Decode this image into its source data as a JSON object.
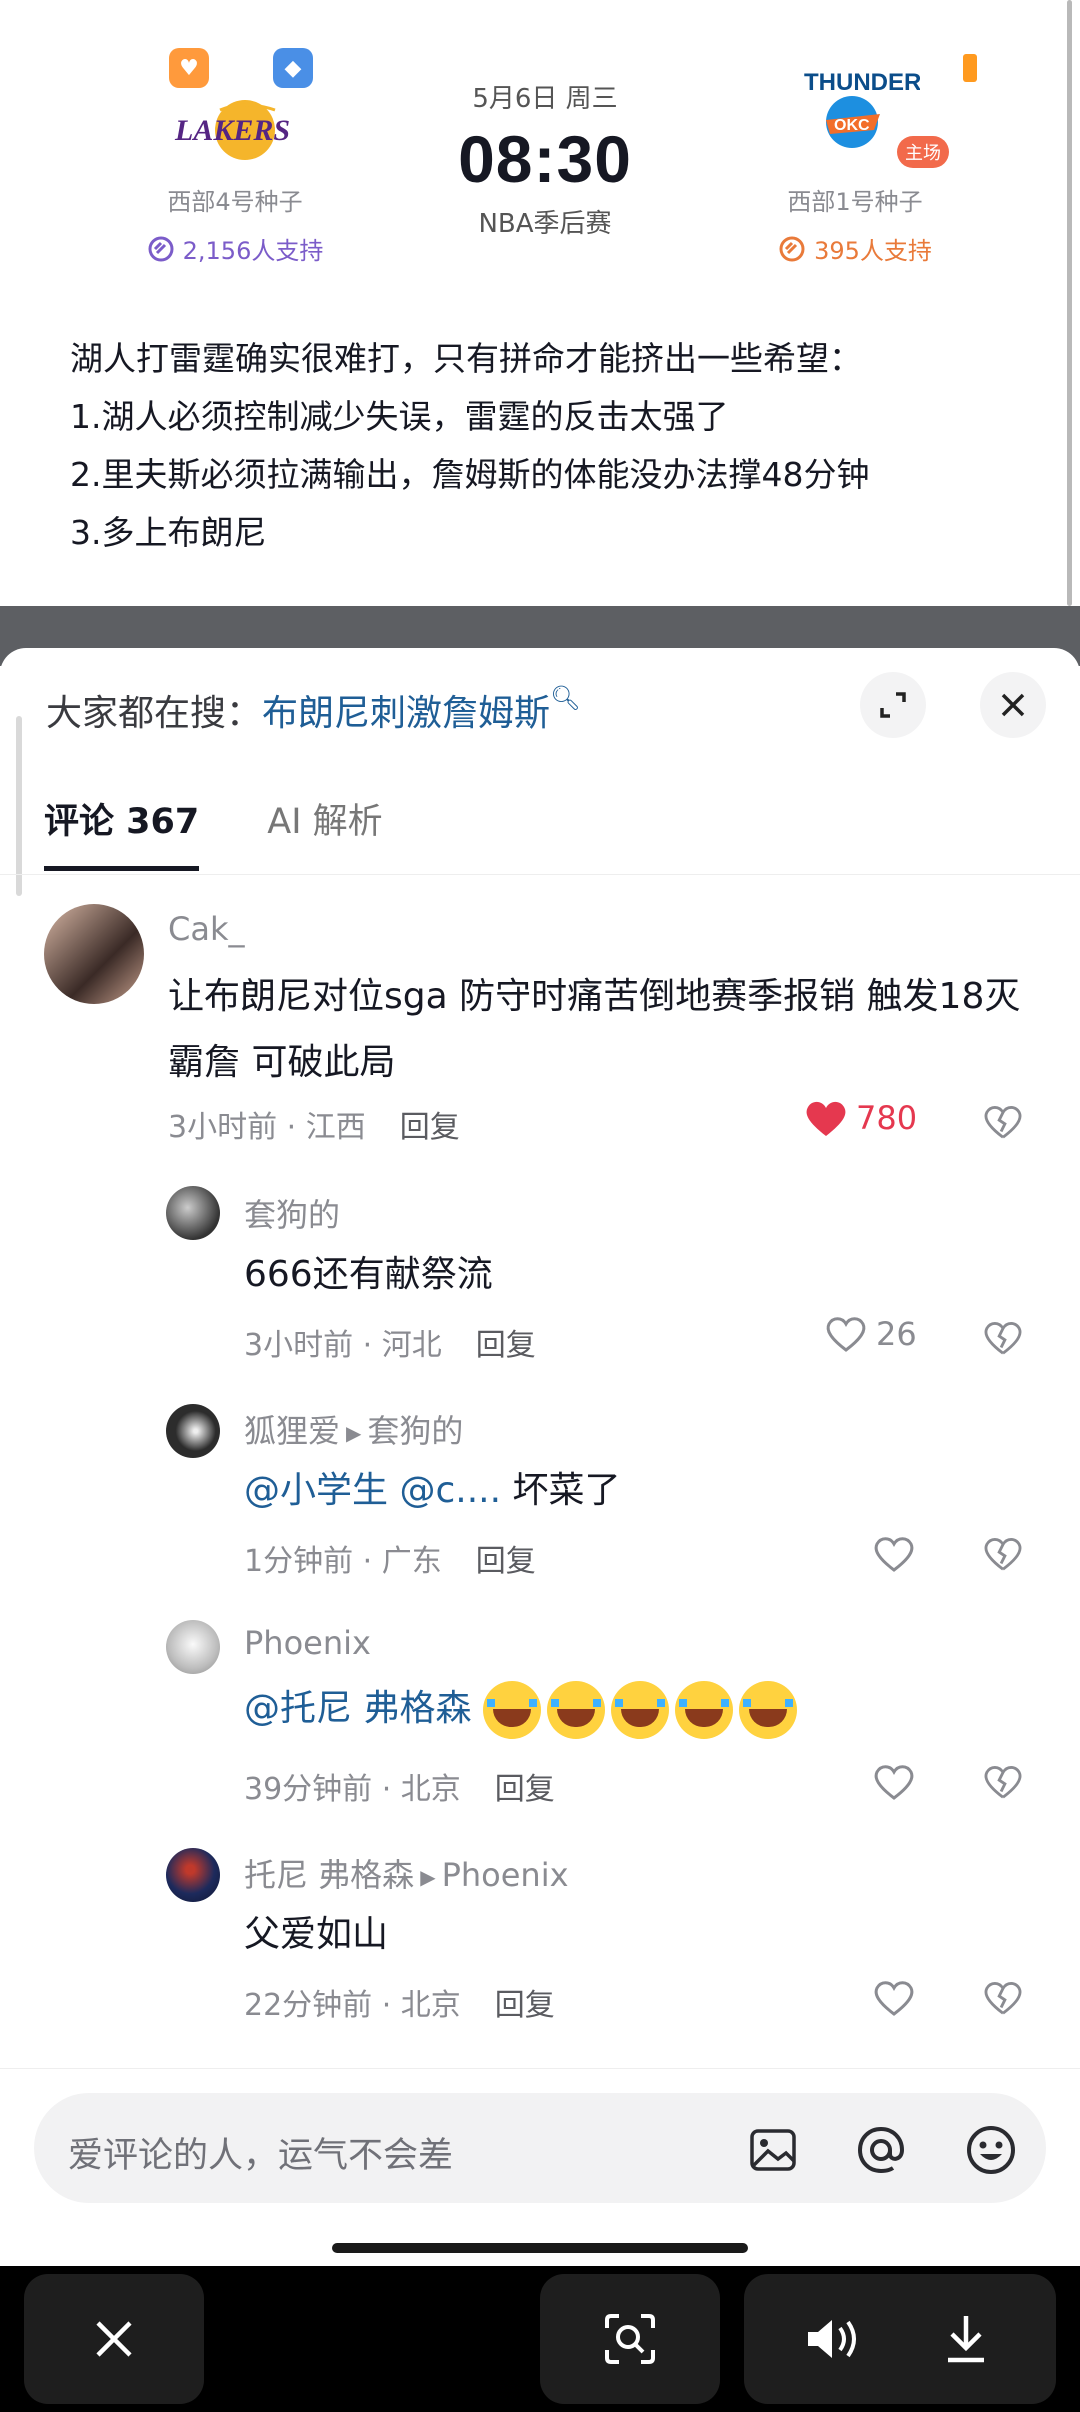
{
  "match": {
    "home_team": {
      "seed": "西部4号种子",
      "support": "2,156人支持"
    },
    "away_team": {
      "seed": "西部1号种子",
      "support": "395人支持",
      "tag": "主场"
    },
    "date": "5月6日 周三",
    "time": "08:30",
    "league": "NBA季后赛"
  },
  "article": {
    "lines": [
      "湖人打雷霆确实很难打，只有拼命才能挤出一些希望：",
      "1.湖人必须控制减少失误，雷霆的反击太强了",
      "2.里夫斯必须拉满输出，詹姆斯的体能没办法撑48分钟",
      "3.多上布朗尼"
    ]
  },
  "sheet": {
    "search_prefix": "大家都在搜：",
    "search_keyword": "布朗尼刺激詹姆斯",
    "tabs": [
      {
        "label": "评论 367",
        "active": true
      },
      {
        "label": "AI 解析",
        "active": false
      }
    ]
  },
  "comments": [
    {
      "author": "Cak_",
      "text": "让布朗尼对位sga 防守时痛苦倒地赛季报销 触发18灭霸詹 可破此局",
      "time": "3小时前",
      "location": "江西",
      "reply": "回复",
      "likes": "780",
      "liked": true
    },
    {
      "author": "套狗的",
      "text": "666还有献祭流",
      "time": "3小时前",
      "location": "河北",
      "reply": "回复",
      "likes": "26"
    },
    {
      "author": "狐狸爱",
      "reply_to": "套狗的",
      "mention1": "@小学生",
      "mention2": "@c....",
      "text_tail": "坏菜了",
      "time": "1分钟前",
      "location": "广东",
      "reply": "回复"
    },
    {
      "author": "Phoenix",
      "mention1": "@托尼 弗格森",
      "time": "39分钟前",
      "location": "北京",
      "reply": "回复"
    },
    {
      "author": "托尼 弗格森",
      "reply_to": "Phoenix",
      "text": "父爱如山",
      "time": "22分钟前",
      "location": "北京",
      "reply": "回复"
    }
  ],
  "input": {
    "placeholder": "爱评论的人，运气不会差"
  },
  "icons": {
    "expand": "expand-icon",
    "close": "close-icon",
    "image": "image-icon",
    "at": "at-icon",
    "emoji": "emoji-icon",
    "heart": "heart-icon",
    "dislike": "broken-heart-icon",
    "search": "search-icon",
    "volume": "volume-icon",
    "download": "download-icon"
  },
  "colors": {
    "link": "#1f5e96",
    "like_red": "#e5384f",
    "home_accent": "#7b5cc9",
    "away_accent": "#e97a3a"
  }
}
